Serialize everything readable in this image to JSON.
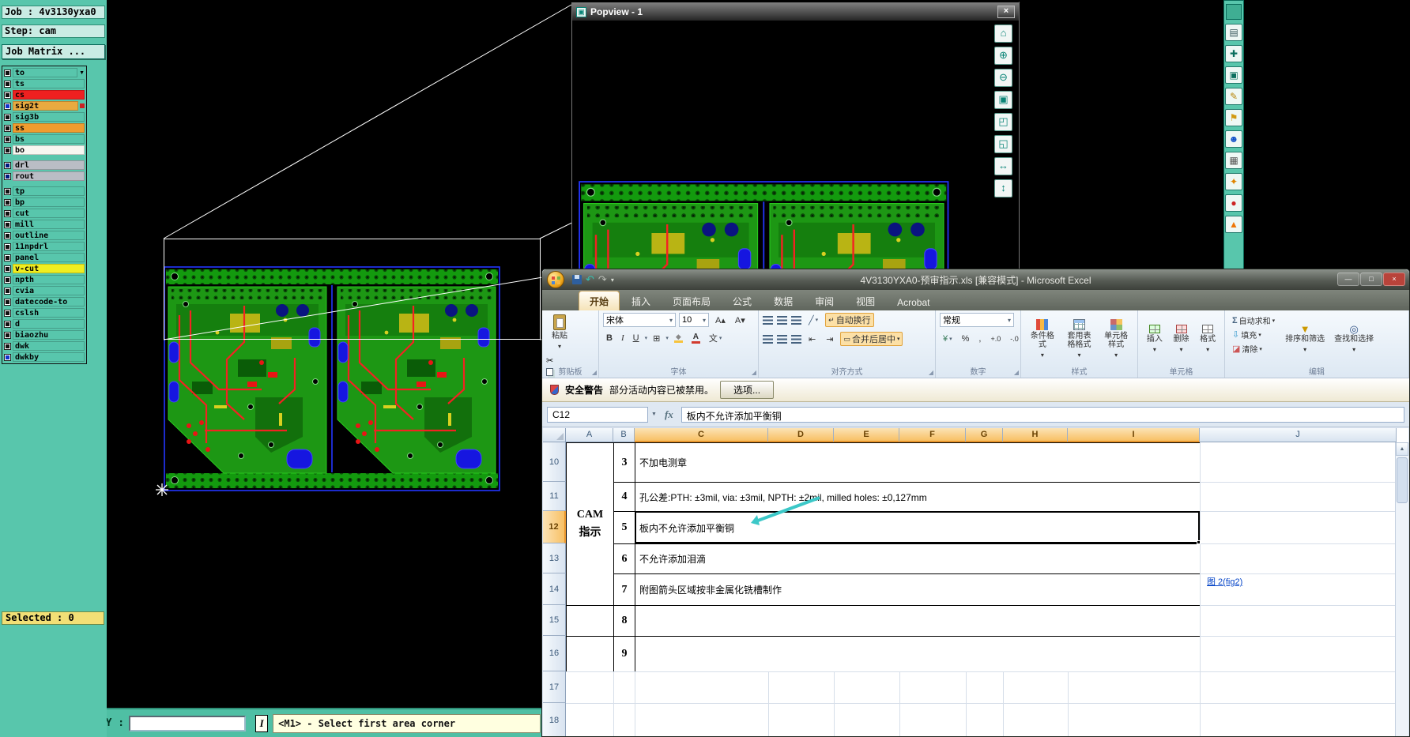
{
  "cam": {
    "job": "Job : 4v3130yxa0",
    "step": "Step: cam",
    "job_matrix": "Job Matrix ...",
    "layers": [
      {
        "name": "to",
        "bg": "#58c6ac",
        "sq": "#111111"
      },
      {
        "name": "ts",
        "bg": "#58c6ac",
        "sq": "#111111"
      },
      {
        "name": "cs",
        "bg": "#ee2020",
        "sq": "#111111"
      },
      {
        "name": "sig2t",
        "bg": "#e9aa40",
        "sq": "#1133cc"
      },
      {
        "name": "sig3b",
        "bg": "#58c6ac",
        "sq": "#111111"
      },
      {
        "name": "ss",
        "bg": "#f09c2e",
        "sq": "#111111"
      },
      {
        "name": "bs",
        "bg": "#58c6ac",
        "sq": "#111111"
      },
      {
        "name": "bo",
        "bg": "#f7f7f1",
        "sq": "#111111"
      },
      {
        "name": "drl",
        "bg": "#babdc5",
        "sq": "#001a80"
      },
      {
        "name": "rout",
        "bg": "#babdc5",
        "sq": "#001a80"
      },
      {
        "name": "tp",
        "bg": "#58c6ac",
        "sq": "#111111"
      },
      {
        "name": "bp",
        "bg": "#58c6ac",
        "sq": "#111111"
      },
      {
        "name": "cut",
        "bg": "#58c6ac",
        "sq": "#111111"
      },
      {
        "name": "mill",
        "bg": "#58c6ac",
        "sq": "#111111"
      },
      {
        "name": "outline",
        "bg": "#58c6ac",
        "sq": "#111111"
      },
      {
        "name": "11npdrl",
        "bg": "#58c6ac",
        "sq": "#111111"
      },
      {
        "name": "panel",
        "bg": "#58c6ac",
        "sq": "#111111"
      },
      {
        "name": "v-cut",
        "bg": "#f1ee20",
        "sq": "#111111"
      },
      {
        "name": "npth",
        "bg": "#58c6ac",
        "sq": "#111111"
      },
      {
        "name": "cvia",
        "bg": "#58c6ac",
        "sq": "#111111"
      },
      {
        "name": "datecode-to",
        "bg": "#58c6ac",
        "sq": "#111111"
      },
      {
        "name": "cslsh",
        "bg": "#58c6ac",
        "sq": "#111111"
      },
      {
        "name": "d",
        "bg": "#58c6ac",
        "sq": "#111111"
      },
      {
        "name": "biaozhu",
        "bg": "#58c6ac",
        "sq": "#111111"
      },
      {
        "name": "dwk",
        "bg": "#58c6ac",
        "sq": "#111111"
      },
      {
        "name": "dwkby",
        "bg": "#58c6ac",
        "sq": "#1133cc"
      }
    ],
    "selected": "Selected : 0",
    "xy_label": "X Y :",
    "xy_value": "",
    "info_btn": "I",
    "status": "<M1> - Select first area corner",
    "tool_icons": [
      "◩",
      "✎",
      "▦"
    ]
  },
  "popview": {
    "title": "Popview - 1",
    "close": "×",
    "tools": [
      "⌂",
      "⊕",
      "⊖",
      "▣",
      "◰",
      "◱",
      "↔",
      "↕"
    ]
  },
  "right_toolbar": [
    {
      "g": "▤",
      "c": "#35555a"
    },
    {
      "g": "✚",
      "c": "#0a6e5e"
    },
    {
      "g": "▣",
      "c": "#0a6e5e"
    },
    {
      "g": "✎",
      "c": "#b8860b"
    },
    {
      "g": "⚑",
      "c": "#d19a12"
    },
    {
      "g": "☻",
      "c": "#1050c8"
    },
    {
      "g": "▦",
      "c": "#555555"
    },
    {
      "g": "✦",
      "c": "#e08400"
    },
    {
      "g": "●",
      "c": "#cc2424"
    },
    {
      "g": "▲",
      "c": "#ee7708"
    }
  ],
  "excel": {
    "title": "4V3130YXA0-预审指示.xls [兼容模式] - Microsoft Excel",
    "window": {
      "min": "—",
      "max": "□",
      "close": "×"
    },
    "tabs": [
      "开始",
      "插入",
      "页面布局",
      "公式",
      "数据",
      "审阅",
      "视图",
      "Acrobat"
    ],
    "ribbon": {
      "clipboard": {
        "group": "剪贴板",
        "paste": "粘贴",
        "cut": "✂",
        "brush": "✎"
      },
      "font": {
        "group": "字体",
        "name": "宋体",
        "size": "10",
        "bold": "B",
        "italic": "I",
        "underline": "U",
        "grow": "A▴",
        "shrink": "A▾",
        "borders": "⊞",
        "fill": "◆",
        "color": "A",
        "pinyin": "文"
      },
      "align": {
        "group": "对齐方式",
        "wrap": "自动换行",
        "merge": "合并后居中",
        "orient": "╱",
        "indent_l": "⇤",
        "indent_r": "⇥"
      },
      "number": {
        "group": "数字",
        "format": "常规",
        "currency": "¥",
        "percent": "%",
        "comma": ",",
        "inc": "+.0",
        "dec": "-.0"
      },
      "styles": {
        "group": "样式",
        "conditional": "条件格式",
        "table": "套用表格格式",
        "cell": "单元格样式"
      },
      "cells": {
        "group": "单元格",
        "insert": "插入",
        "delete": "删除",
        "format": "格式"
      },
      "editing": {
        "group": "编辑",
        "sum": "Σ",
        "autosum": "自动求和",
        "fill": "填充",
        "clear": "清除",
        "sort": "排序和筛选",
        "find": "查找和选择"
      }
    },
    "security": {
      "label": "安全警告",
      "message": "部分活动内容已被禁用。",
      "options": "选项..."
    },
    "formula_bar": {
      "name_box": "C12",
      "fx": "fx",
      "value": "板内不允许添加平衡铜"
    },
    "columns": [
      "A",
      "B",
      "C",
      "D",
      "E",
      "F",
      "G",
      "H",
      "I",
      "J"
    ],
    "row_numbers": [
      "10",
      "11",
      "12",
      "13",
      "14",
      "15",
      "16",
      "17",
      "18"
    ],
    "merged_cell": {
      "line1": "CAM",
      "line2": "指示"
    },
    "table_rows": [
      {
        "item": "3",
        "text": "不加电测章"
      },
      {
        "item": "4",
        "text": "孔公差:PTH: ±3mil,  via: ±3mil,  NPTH: ±2mil,  milled holes: ±0,127mm"
      },
      {
        "item": "5",
        "text": "板内不允许添加平衡铜"
      },
      {
        "item": "6",
        "text": "不允许添加泪滴"
      },
      {
        "item": "7",
        "text": "附图箭头区域按非金属化铣槽制作"
      },
      {
        "item": "8",
        "text": ""
      },
      {
        "item": "9",
        "text": ""
      }
    ],
    "link_fig2": "图 2(fig2)"
  },
  "colors": {
    "cam_teal": "#58c6ac",
    "selection_blue": "#2436ff",
    "annotation_teal": "#3cc8c8",
    "header_selected": "#f8c064",
    "link_blue": "#0645c8",
    "status_yellow": "#ffffe0"
  }
}
